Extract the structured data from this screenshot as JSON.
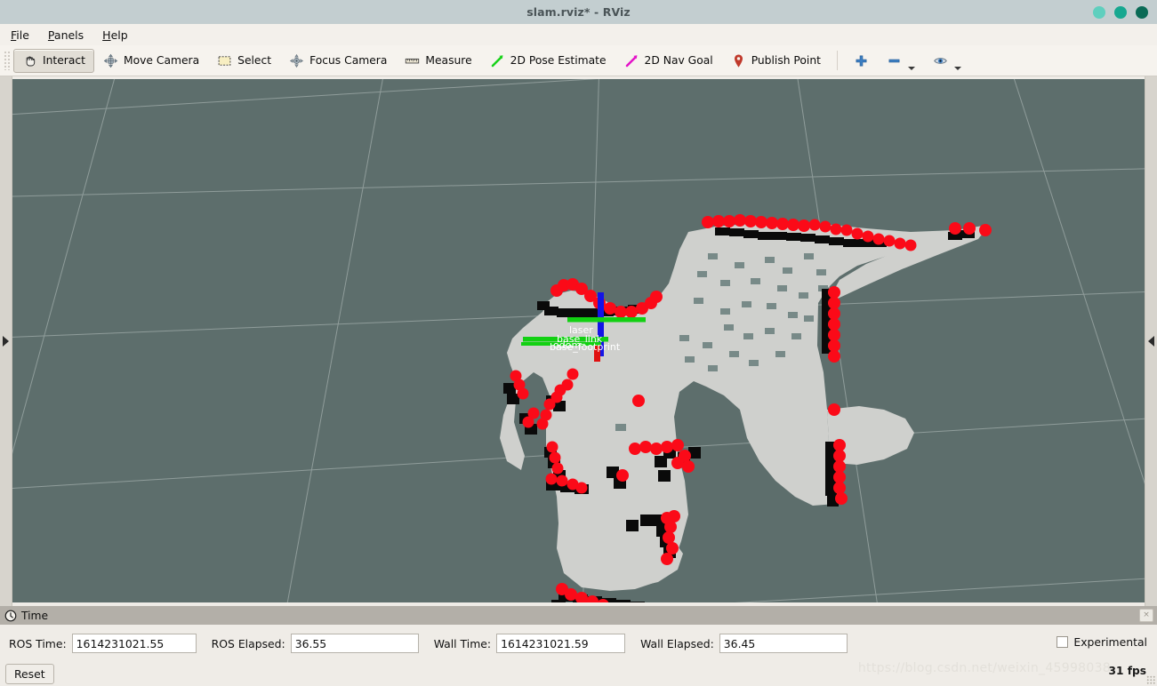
{
  "window": {
    "title": "slam.rviz* - RViz",
    "buttons": [
      {
        "name": "minimize",
        "color": "#5fcfbe"
      },
      {
        "name": "maximize",
        "color": "#17a890"
      },
      {
        "name": "close",
        "color": "#0a6b56"
      }
    ]
  },
  "menubar": {
    "items": [
      {
        "label": "File",
        "accel": "F"
      },
      {
        "label": "Panels",
        "accel": "P"
      },
      {
        "label": "Help",
        "accel": "H"
      }
    ]
  },
  "toolbar": {
    "tools": [
      {
        "label": "Interact",
        "icon": "hand-icon",
        "active": true
      },
      {
        "label": "Move Camera",
        "icon": "move-camera-icon",
        "active": false
      },
      {
        "label": "Select",
        "icon": "select-rect-icon",
        "active": false
      },
      {
        "label": "Focus Camera",
        "icon": "focus-camera-icon",
        "active": false
      },
      {
        "label": "Measure",
        "icon": "ruler-icon",
        "active": false
      },
      {
        "label": "2D Pose Estimate",
        "icon": "green-arrow-icon",
        "active": false
      },
      {
        "label": "2D Nav Goal",
        "icon": "magenta-arrow-icon",
        "active": false
      },
      {
        "label": "Publish Point",
        "icon": "map-pin-icon",
        "active": false
      }
    ],
    "right_icons": [
      {
        "name": "add-tool-icon",
        "glyph": "plus",
        "color": "#2a6ebb"
      },
      {
        "name": "remove-tool-icon",
        "glyph": "minus",
        "color": "#2a6ebb",
        "dropdown": true
      },
      {
        "name": "visibility-icon",
        "glyph": "eye",
        "color": "#2a6ebb",
        "dropdown": true
      }
    ]
  },
  "viewport": {
    "background_color": "#5d6e6c",
    "grid_color": "#b9c3c1",
    "free_cell_color": "#cfd0cd",
    "occupied_cell_color": "#0a0a0a",
    "laser_point_color": "#fb0a18",
    "tf_labels": [
      "laser",
      "base_link",
      "base_footprint",
      "odom"
    ],
    "axis_colors": {
      "x": "#e01010",
      "y": "#12d012",
      "z": "#1414e6"
    },
    "left_panel_handle": "expand-left-panel",
    "right_panel_handle": "expand-right-panel"
  },
  "time_panel": {
    "header": "Time",
    "close_label": "×",
    "fields": [
      {
        "label": "ROS Time:",
        "value": "1614231021.55"
      },
      {
        "label": "ROS Elapsed:",
        "value": "36.55"
      },
      {
        "label": "Wall Time:",
        "value": "1614231021.59"
      },
      {
        "label": "Wall Elapsed:",
        "value": "36.45"
      }
    ],
    "experimental_label": "Experimental",
    "experimental_checked": false,
    "reset_label": "Reset"
  },
  "status": {
    "fps": "31 fps",
    "watermark": "https://blog.csdn.net/weixin_45998038"
  }
}
